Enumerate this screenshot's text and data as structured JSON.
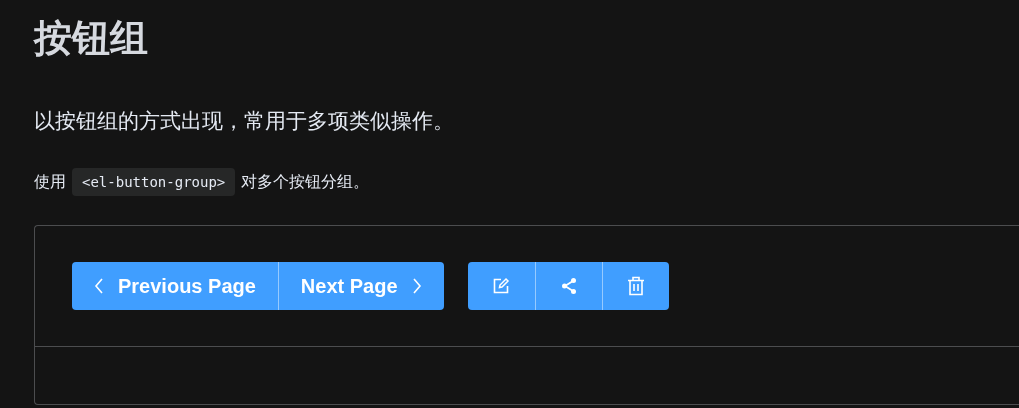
{
  "title": "按钮组",
  "description": "以按钮组的方式出现，常用于多项类似操作。",
  "usage": {
    "before": "使用",
    "code": "<el-button-group>",
    "after": "对多个按钮分组。"
  },
  "demo": {
    "groups": [
      {
        "buttons": [
          {
            "label": "Previous Page",
            "kind": "prev"
          },
          {
            "label": "Next Page",
            "kind": "next"
          }
        ]
      },
      {
        "buttons": [
          {
            "kind": "edit"
          },
          {
            "kind": "share"
          },
          {
            "kind": "delete"
          }
        ]
      }
    ]
  }
}
